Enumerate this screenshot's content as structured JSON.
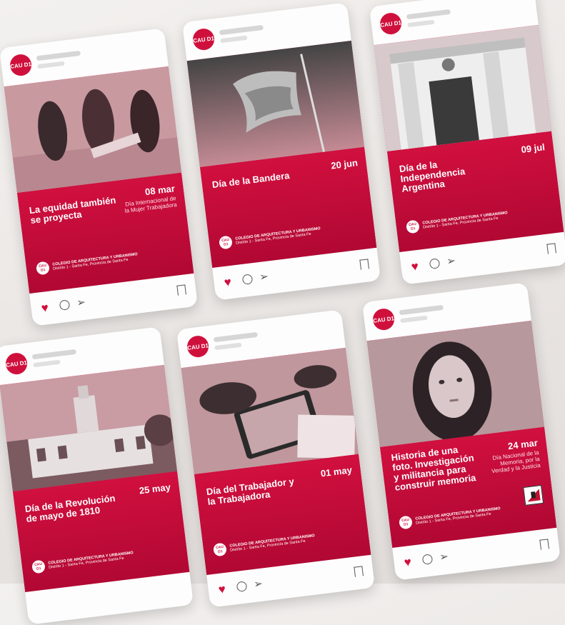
{
  "brand": {
    "avatar": "CAU D1",
    "accent": "#d0103c"
  },
  "posts": [
    {
      "title": "La equidad también se proyecta",
      "date": "08 mar",
      "subtitle": "Día Internacional de la Mujer Trabajadora",
      "org": "COLEGIO DE ARQUITECTURA Y URBANISMO",
      "district": "Distrito 1 - Santa Fe, Provincia de Santa Fe",
      "photo": "women-drawing-plans"
    },
    {
      "title": "Día de la Bandera",
      "date": "20 jun",
      "subtitle": "",
      "org": "COLEGIO DE ARQUITECTURA Y URBANISMO",
      "district": "Distrito 1 - Santa Fe, Provincia de Santa Fe",
      "photo": "flag-on-pole"
    },
    {
      "title": "Día de la Independencia Argentina",
      "date": "09 jul",
      "subtitle": "",
      "org": "COLEGIO DE ARQUITECTURA Y URBANISMO",
      "district": "Distrito 1 - Santa Fe, Provincia de Santa Fe",
      "photo": "casa-historica"
    },
    {
      "title": "Día de la Revolución de mayo de 1810",
      "date": "25 may",
      "subtitle": "",
      "org": "COLEGIO DE ARQUITECTURA Y URBANISMO",
      "district": "Distrito 1 - Santa Fe, Provincia de Santa Fe",
      "photo": "cabildo"
    },
    {
      "title": "Día del Trabajador y la Trabajadora",
      "date": "01 may",
      "subtitle": "",
      "org": "COLEGIO DE ARQUITECTURA Y URBANISMO",
      "district": "Distrito 1 - Santa Fe, Provincia de Santa Fe",
      "photo": "tablet-drawing"
    },
    {
      "title": "Historia de una foto. Investigación y militancia para construir memoria",
      "date": "24 mar",
      "subtitle": "Día Nacional de la Memoria, por la Verdad y la Justicia",
      "org": "COLEGIO DE ARQUITECTURA Y URBANISMO",
      "district": "Distrito 1 - Santa Fe, Provincia de Santa Fe",
      "photo": "portrait-woman"
    }
  ]
}
